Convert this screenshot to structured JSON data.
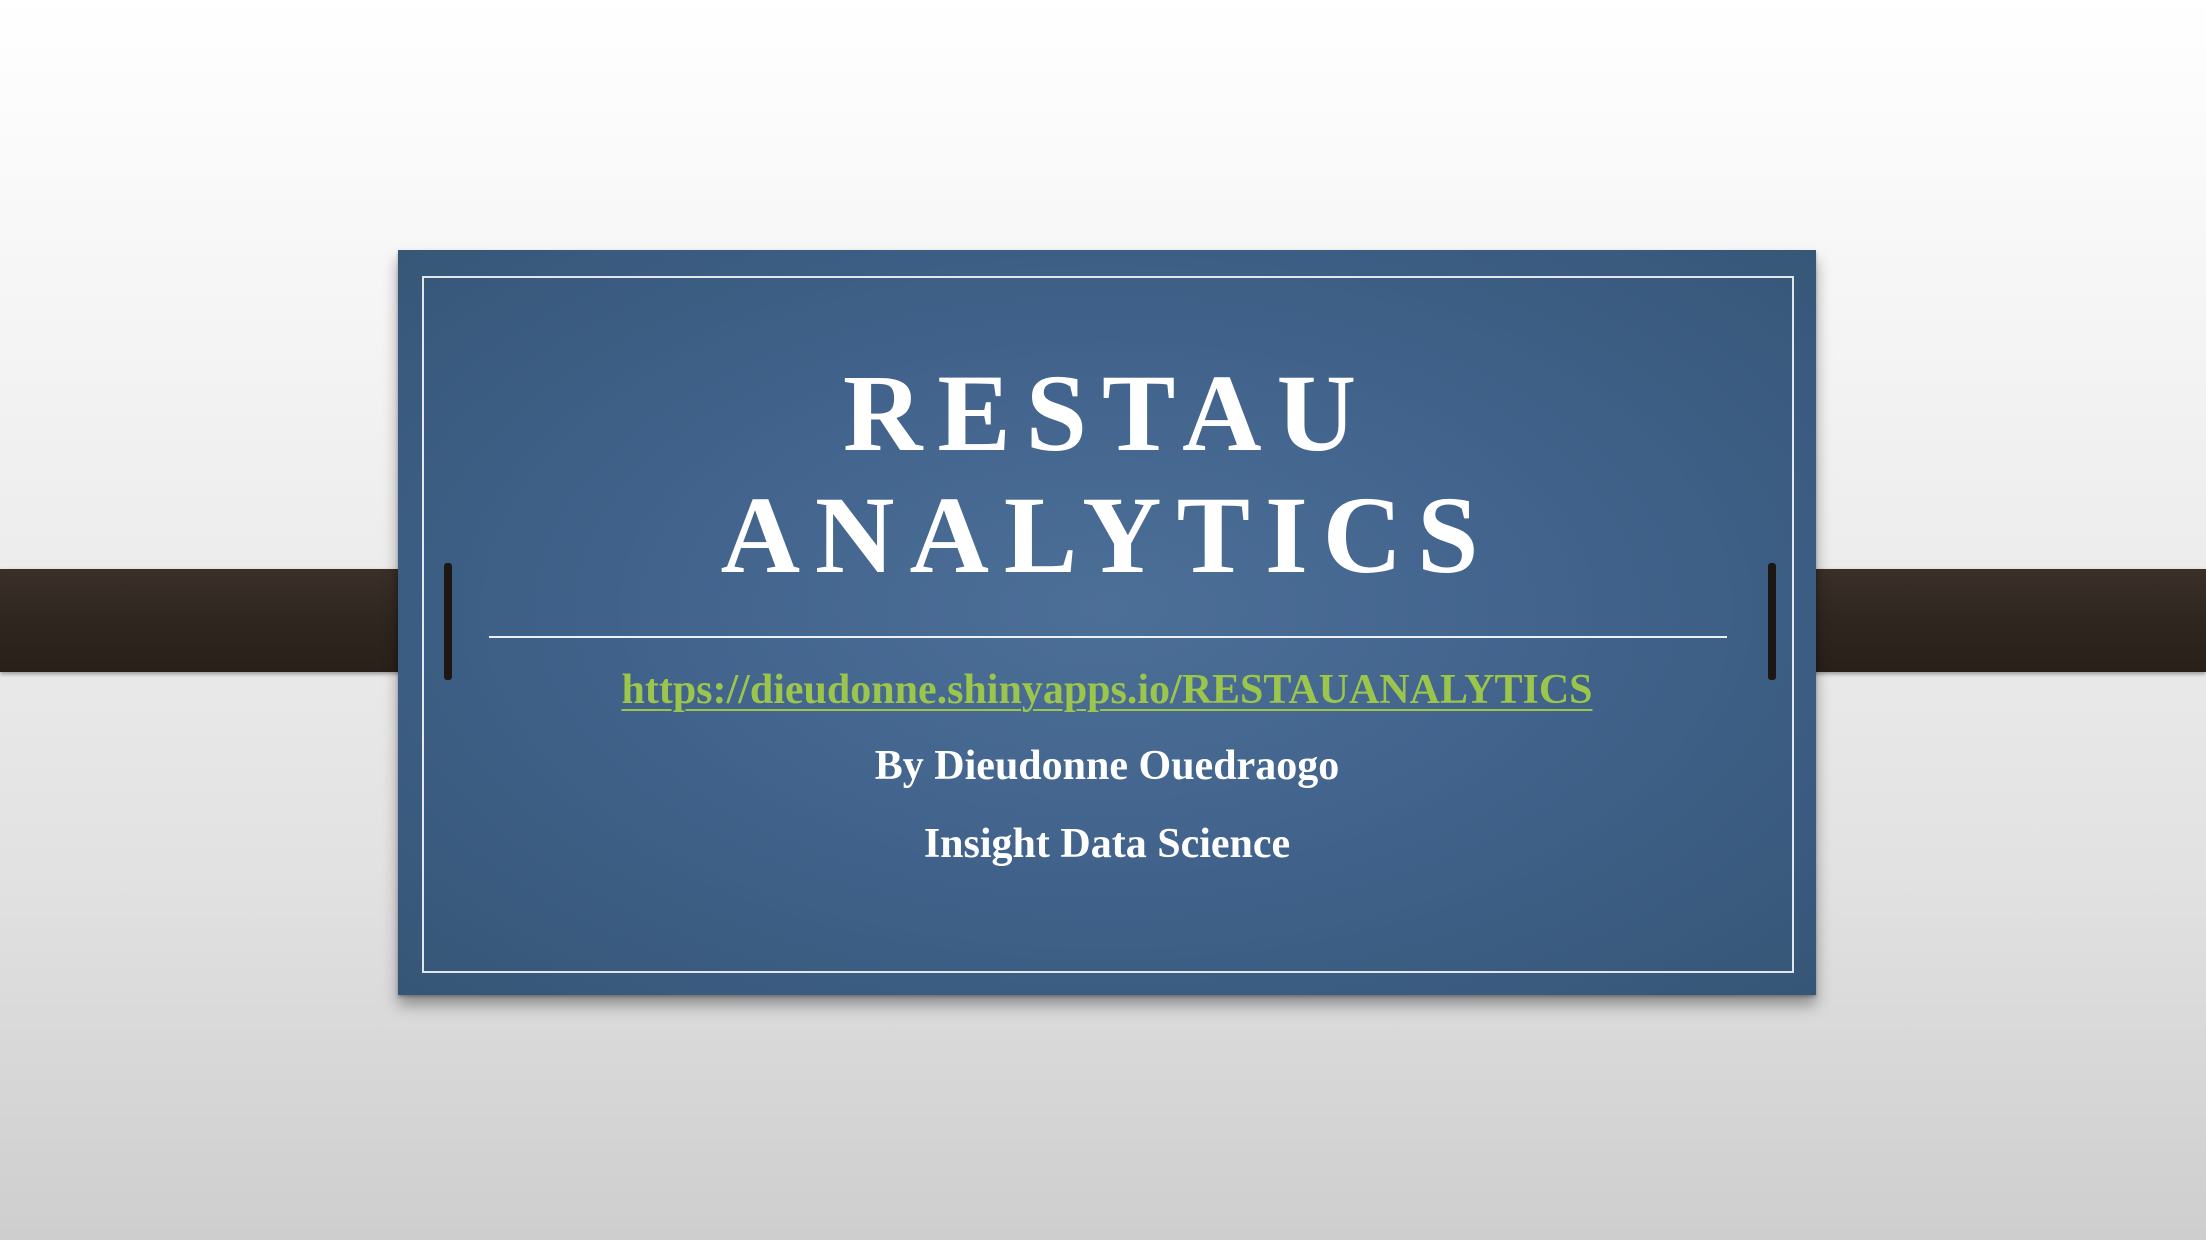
{
  "slide": {
    "title_line1": "RESTAU",
    "title_line2": "ANALYTICS",
    "link": "https://dieudonne.shinyapps.io/RESTAUANALYTICS",
    "author": "By Dieudonne Ouedraogo",
    "organization": "Insight Data Science"
  },
  "colors": {
    "card_background": "#41638c",
    "link": "#9bc54b",
    "text": "#ffffff",
    "strap": "#2f2620"
  }
}
